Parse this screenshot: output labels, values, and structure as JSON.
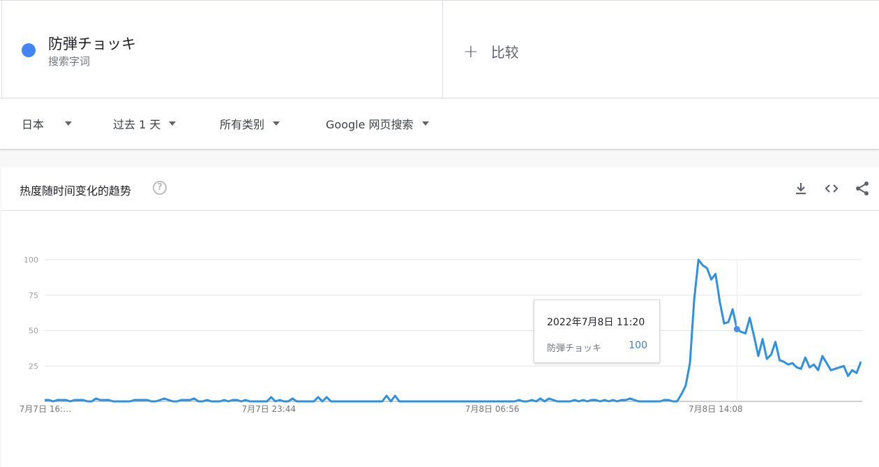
{
  "search_term": {
    "name": "防弾チョッキ",
    "subtitle": "搜索字词",
    "color": "#4285f4"
  },
  "compare": {
    "label": "比较"
  },
  "filters": {
    "region": "日本",
    "time_range": "过去 1 天",
    "category": "所有类别",
    "search_type": "Google 网页搜索"
  },
  "panel": {
    "title": "热度随时间变化的趋势",
    "icons": [
      "help-icon",
      "download-icon",
      "embed-icon",
      "share-icon"
    ]
  },
  "tooltip": {
    "date": "2022年7月8日 11:20",
    "term": "防弾チョッキ",
    "value": "100"
  },
  "chart_data": {
    "type": "line",
    "series": [
      {
        "name": "防弾チョッキ",
        "color": "#2d91e0",
        "values": [
          1,
          1,
          0,
          1,
          1,
          1,
          0,
          1,
          1,
          1,
          0,
          0,
          2,
          1,
          1,
          1,
          0,
          0,
          0,
          0,
          0,
          1,
          1,
          1,
          1,
          0,
          0,
          1,
          2,
          1,
          0,
          0,
          1,
          1,
          1,
          2,
          0,
          0,
          1,
          0,
          0,
          0,
          1,
          0,
          1,
          1,
          0,
          1,
          0,
          0,
          0,
          0,
          0,
          3,
          0,
          1,
          0,
          0,
          2,
          0,
          0,
          0,
          0,
          0,
          3,
          0,
          3,
          0,
          0,
          0,
          0,
          0,
          0,
          0,
          0,
          0,
          0,
          0,
          0,
          0,
          4,
          0,
          4,
          0,
          0,
          0,
          0,
          0,
          0,
          0,
          0,
          0,
          0,
          0,
          0,
          0,
          0,
          0,
          0,
          0,
          0,
          0,
          0,
          0,
          0,
          0,
          0,
          0,
          0,
          0,
          0,
          1,
          0,
          0,
          1,
          0,
          2,
          0,
          2,
          1,
          0,
          0,
          0,
          0,
          1,
          0,
          1,
          0,
          1,
          1,
          0,
          1,
          0,
          1,
          0,
          1,
          1,
          2,
          1,
          0,
          0,
          0,
          0,
          0,
          0,
          1,
          1,
          0,
          0,
          5,
          11,
          27,
          72,
          100,
          96,
          94,
          86,
          90,
          70,
          55,
          56,
          65,
          51,
          49,
          48,
          59,
          46,
          32,
          44,
          30,
          33,
          42,
          29,
          28,
          26,
          27,
          24,
          23,
          31,
          24,
          26,
          22,
          32,
          27,
          22,
          23,
          24,
          25,
          18,
          22,
          20,
          28
        ]
      }
    ],
    "x_tick_labels": [
      "7月7日 16:…",
      "7月7日 23:44",
      "7月8日 06:56",
      "7月8日 14:08"
    ],
    "y_ticks": [
      25,
      50,
      75,
      100
    ],
    "ylim": [
      0,
      100
    ],
    "highlight_index": 162,
    "grid": true
  }
}
